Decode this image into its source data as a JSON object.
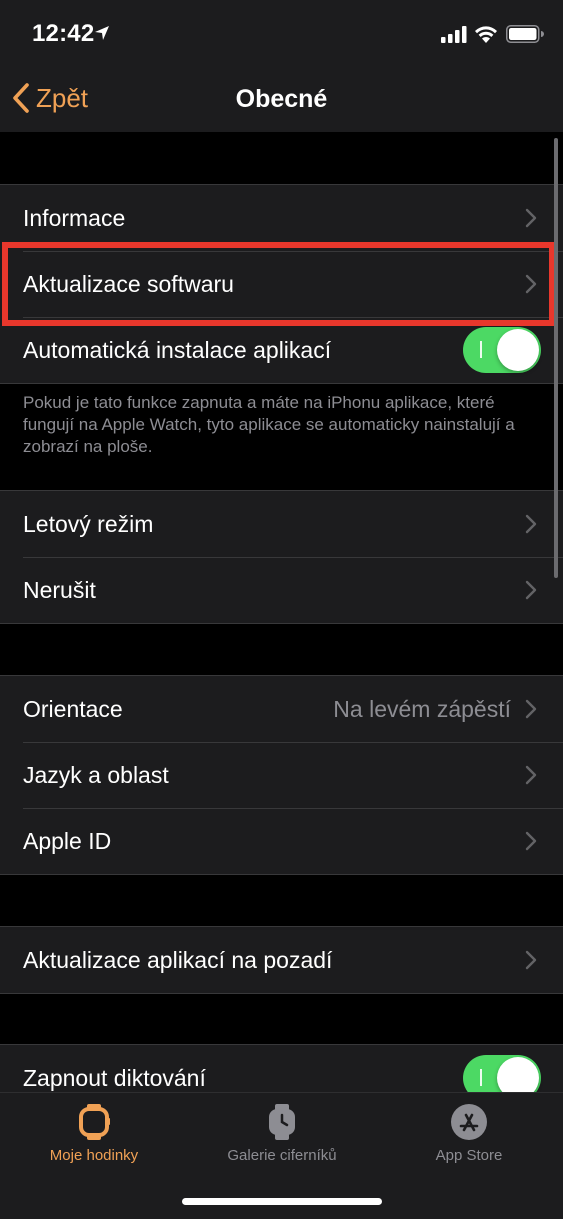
{
  "status_bar": {
    "time": "12:42"
  },
  "nav": {
    "back_label": "Zpět",
    "title": "Obecné"
  },
  "sections": {
    "general": {
      "informace": "Informace",
      "software_update": "Aktualizace softwaru",
      "auto_install": "Automatická instalace aplikací",
      "auto_install_on": true
    },
    "auto_install_note": "Pokud je tato funkce zapnuta a máte na iPhonu aplikace, které fungují na Apple Watch, tyto aplikace se automaticky nainstalují a zobrazí na ploše.",
    "modes": {
      "airplane": "Letový režim",
      "dnd": "Nerušit"
    },
    "device": {
      "orientation": "Orientace",
      "orientation_value": "Na levém zápěstí",
      "language": "Jazyk a oblast",
      "apple_id": "Apple ID"
    },
    "background": {
      "bg_refresh": "Aktualizace aplikací na pozadí"
    },
    "dictation": {
      "dictation": "Zapnout diktování",
      "dictation_on": true
    }
  },
  "tabs": [
    {
      "label": "Moje hodinky",
      "icon": "watch-icon",
      "active": true
    },
    {
      "label": "Galerie ciferníků",
      "icon": "watch-face-gallery-icon",
      "active": false
    },
    {
      "label": "App Store",
      "icon": "app-store-icon",
      "active": false
    }
  ],
  "colors": {
    "accent": "#f0a155",
    "toggle_on": "#4cd964",
    "highlight": "#e8372c",
    "cell_bg": "#1c1c1e",
    "secondary_text": "#8d8d93",
    "tab_inactive": "#8d8d93"
  }
}
